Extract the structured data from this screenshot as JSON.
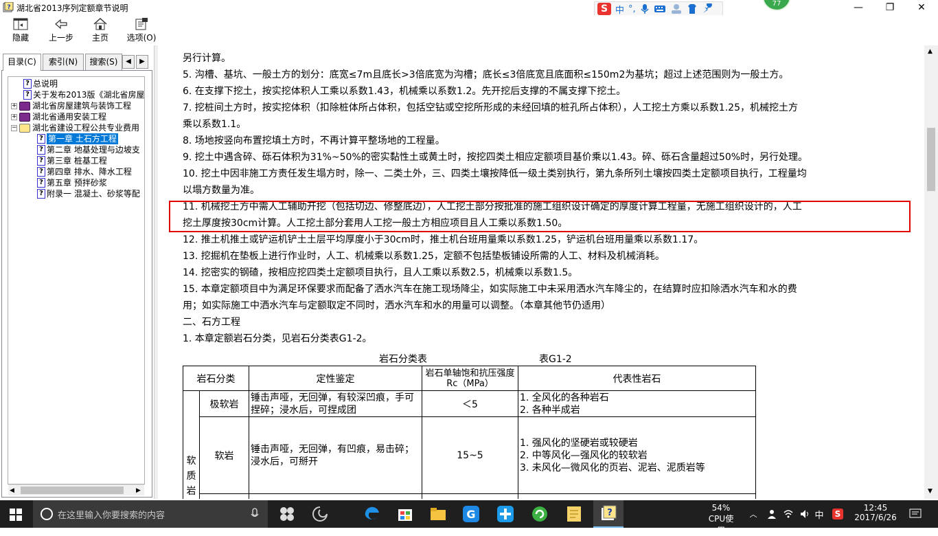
{
  "window": {
    "title": "湖北省2013序列定额章节说明",
    "minimize": "—",
    "restore": "❐",
    "close": "✕"
  },
  "ime": {
    "logo": "S",
    "lang": "中",
    "punct": "°,",
    "icons": [
      "mic-icon",
      "keyboard-icon",
      "person-icon",
      "shirt-icon",
      "wrench-icon"
    ]
  },
  "badge": "77",
  "toolbar": {
    "hide": "隐藏",
    "back": "上一步",
    "home": "主页",
    "options": "选项(O)"
  },
  "tabs": {
    "contents": "目录(C)",
    "index": "索引(N)",
    "search": "搜索(S)",
    "prev": "◀",
    "next": "▶"
  },
  "tree": [
    {
      "label": "总说明",
      "type": "page",
      "level": 1
    },
    {
      "label": "关于发布2013版《湖北省房屋",
      "type": "page",
      "level": 1
    },
    {
      "label": "湖北省房屋建筑与装饰工程",
      "type": "book",
      "level": 0,
      "expander": "+"
    },
    {
      "label": "湖北省通用安装工程",
      "type": "book",
      "level": 0,
      "expander": "+"
    },
    {
      "label": "湖北省建设工程公共专业费用",
      "type": "openbook",
      "level": 0,
      "expander": "−"
    },
    {
      "label": "第一章 土石方工程",
      "type": "page",
      "level": 2,
      "selected": true
    },
    {
      "label": "第二章 地基处理与边坡支",
      "type": "page",
      "level": 2
    },
    {
      "label": "第三章 桩基工程",
      "type": "page",
      "level": 2
    },
    {
      "label": "第四章 排水、降水工程",
      "type": "page",
      "level": 2
    },
    {
      "label": "第五章 预拌砂浆",
      "type": "page",
      "level": 2
    },
    {
      "label": "附录一 混凝土、砂浆等配",
      "type": "page",
      "level": 2
    }
  ],
  "content": {
    "lines": [
      "另行计算。",
      "5. 沟槽、基坑、一般土方的划分：底宽≤7m且底长>3倍底宽为沟槽；底长≤3倍底宽且底面积≤150m2为基坑；超过上述范围则为一般土方。",
      "6. 在支撑下挖土，按实挖体积人工乘以系数1.43，机械乘以系数1.2。先开挖后支撑的不属支撑下挖土。",
      "7. 挖桩间土方时，按实挖体积（扣除桩体所占体积，包括空钻或空挖所形成的未经回填的桩孔所占体积），人工挖土方乘以系数1.25，机械挖土方",
      "乘以系数1.1。",
      "8. 场地按竖向布置挖填土方时，不再计算平整场地的工程量。",
      "9. 挖土中遇含碎、砾石体积为31%~50%的密实黏性土或黄土时，按挖四类土相应定额项目基价乘以1.43。碎、砾石含量超过50%时，另行处理。",
      "10. 挖土中因非施工方责任发生塌方时，除一、二类土外，三、四类土壤按降低一级土类别执行，第九条所列土壤按四类土定额项目执行，工程量均",
      "以塌方数量为准。",
      "11. 机械挖土方中需人工辅助开挖（包括切边、修整底边），人工挖土部分按批准的施工组织设计确定的厚度计算工程量，无施工组织设计的，人工",
      "挖土厚度按30cm计算。人工挖土部分套用人工挖一般土方相应项目且人工乘以系数1.50。",
      "12. 推土机推土或铲运机铲土土层平均厚度小于30cm时，推土机台班用量乘以系数1.25，铲运机台班用量乘以系数1.17。",
      "13. 挖掘机在垫板上进行作业时，人工、机械乘以系数1.25，定额不包括垫板铺设所需的人工、材料及机械消耗。",
      "14. 挖密实的钢碴，按相应挖四类土定额项目执行，且人工乘以系数2.5，机械乘以系数1.5。",
      "15. 本章定额项目中为满足环保要求而配备了洒水汽车在施工现场降尘，如实际施工中未采用洒水汽车降尘的，在结算时应扣除洒水汽车和水的费",
      "用；如实际施工中洒水汽车与定额取定不同时，洒水汽车和水的用量可以调整。（本章其他节仍适用）",
      "二、石方工程",
      "1. 本章定额岩石分类，见岩石分类表G1-2。"
    ],
    "table_caption": "岩石分类表",
    "table_code": "表G1-2",
    "table": {
      "headers": [
        "岩石分类",
        "定性鉴定",
        "岩石单轴饱和抗压强度Rc（MPa）",
        "代表性岩石"
      ],
      "group": "软质岩",
      "rows": [
        {
          "class": "极软岩",
          "qual": "锤击声哑，无回弹，有较深凹痕，手可捏碎；浸水后，可捏成团",
          "strength": "＜5",
          "rocks": [
            "1. 全风化的各种岩石",
            "2. 各种半成岩"
          ]
        },
        {
          "class": "软岩",
          "qual": "锤击声哑，无回弹，有凹痕，易击碎；浸水后，可掰开",
          "strength": "15~5",
          "rocks": [
            "1. 强风化的坚硬岩或较硬岩",
            "2. 中等风化—强风化的较软岩",
            "3. 未风化—微风化的页岩、泥岩、泥质岩等"
          ]
        }
      ]
    }
  },
  "taskbar": {
    "search_placeholder": "在这里输入你要搜索的内容",
    "cpu_percent": "54%",
    "cpu_label": "CPU使用",
    "lang": "中",
    "time": "12:45",
    "date": "2017/6/26"
  }
}
